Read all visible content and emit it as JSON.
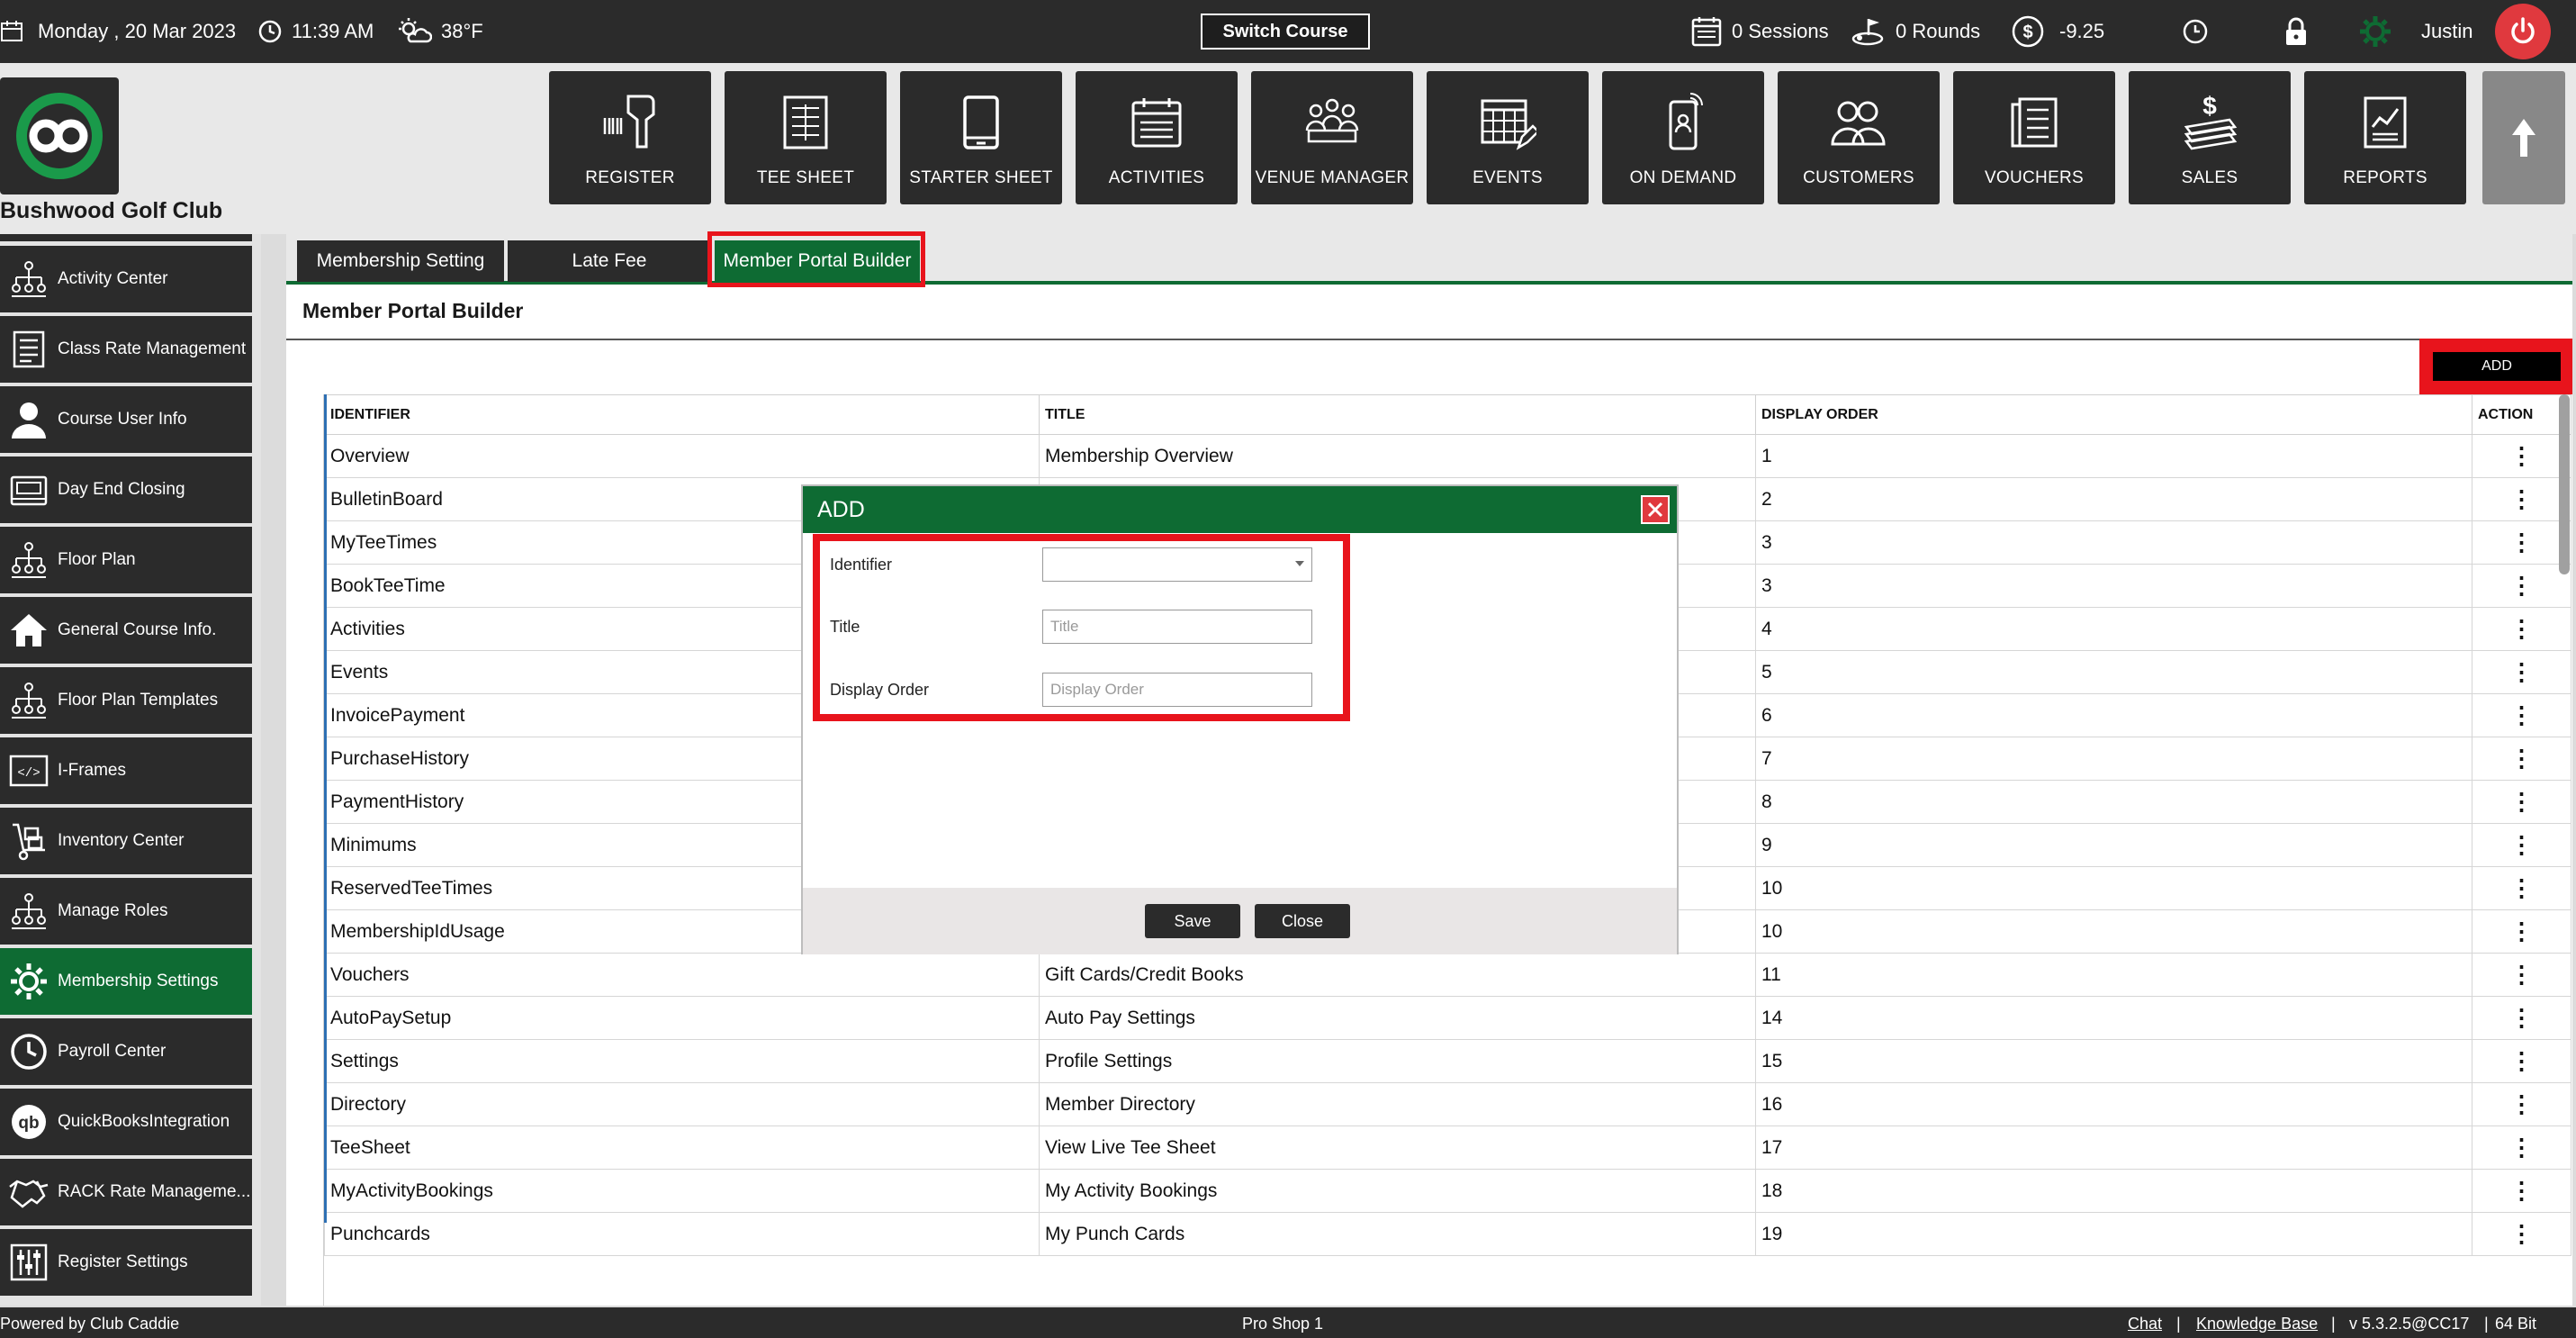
{
  "topbar": {
    "date": "Monday ,  20 Mar 2023",
    "time": "11:39 AM",
    "weather": "38°F",
    "switch_course": "Switch Course",
    "sessions": "0 Sessions",
    "rounds": "0 Rounds",
    "balance": "-9.25",
    "user": "Justin"
  },
  "club": {
    "name": "Bushwood Golf Club"
  },
  "modules": [
    {
      "label": "REGISTER",
      "icon": "barcode-scanner-icon"
    },
    {
      "label": "TEE SHEET",
      "icon": "tee-sheet-icon"
    },
    {
      "label": "STARTER SHEET",
      "icon": "tablet-icon"
    },
    {
      "label": "ACTIVITIES",
      "icon": "calendar-icon"
    },
    {
      "label": "VENUE MANAGER",
      "icon": "venue-people-icon"
    },
    {
      "label": "EVENTS",
      "icon": "events-calendar-icon"
    },
    {
      "label": "ON DEMAND",
      "icon": "mobile-phone-icon"
    },
    {
      "label": "CUSTOMERS",
      "icon": "customers-icon"
    },
    {
      "label": "VOUCHERS",
      "icon": "voucher-icon"
    },
    {
      "label": "SALES",
      "icon": "sales-money-icon"
    },
    {
      "label": "REPORTS",
      "icon": "report-chart-icon"
    }
  ],
  "sidebar": {
    "items": [
      {
        "label": "Activity  Center",
        "icon": "hierarchy-icon"
      },
      {
        "label": "Class Rate Management",
        "icon": "document-list-icon"
      },
      {
        "label": "Course User Info",
        "icon": "user-icon"
      },
      {
        "label": "Day End Closing",
        "icon": "cash-register-icon"
      },
      {
        "label": "Floor Plan",
        "icon": "hierarchy-icon"
      },
      {
        "label": "General Course Info.",
        "icon": "home-icon"
      },
      {
        "label": "Floor Plan Templates",
        "icon": "hierarchy-icon"
      },
      {
        "label": "I-Frames",
        "icon": "code-icon"
      },
      {
        "label": "Inventory Center",
        "icon": "hand-truck-icon"
      },
      {
        "label": "Manage Roles",
        "icon": "hierarchy-icon"
      },
      {
        "label": "Membership Settings",
        "icon": "gear-icon",
        "active": true
      },
      {
        "label": "Payroll Center",
        "icon": "clock-icon"
      },
      {
        "label": "QuickBooksIntegration",
        "icon": "quickbooks-icon"
      },
      {
        "label": "RACK Rate Manageme...",
        "icon": "handshake-icon"
      },
      {
        "label": "Register Settings",
        "icon": "sliders-icon"
      }
    ]
  },
  "tabs": [
    {
      "label": "Membership Setting"
    },
    {
      "label": "Late Fee"
    },
    {
      "label": "Member Portal Builder",
      "active": true
    }
  ],
  "page": {
    "title": "Member Portal Builder",
    "add_label": "ADD"
  },
  "table": {
    "headers": [
      "IDENTIFIER",
      "TITLE",
      "DISPLAY ORDER",
      "ACTION"
    ],
    "rows": [
      [
        "Overview",
        "Membership Overview",
        "1"
      ],
      [
        "BulletinBoard",
        "",
        "2"
      ],
      [
        "MyTeeTimes",
        "",
        "3"
      ],
      [
        "BookTeeTime",
        "",
        "3"
      ],
      [
        "Activities",
        "",
        "4"
      ],
      [
        "Events",
        "",
        "5"
      ],
      [
        "InvoicePayment",
        "",
        "6"
      ],
      [
        "PurchaseHistory",
        "",
        "7"
      ],
      [
        "PaymentHistory",
        "",
        "8"
      ],
      [
        "Minimums",
        "",
        "9"
      ],
      [
        "ReservedTeeTimes",
        "",
        "10"
      ],
      [
        "MembershipIdUsage",
        "",
        "10"
      ],
      [
        "Vouchers",
        "Gift Cards/Credit Books",
        "11"
      ],
      [
        "AutoPaySetup",
        "Auto Pay Settings",
        "14"
      ],
      [
        "Settings",
        "Profile Settings",
        "15"
      ],
      [
        "Directory",
        "Member Directory",
        "16"
      ],
      [
        "TeeSheet",
        "View Live Tee Sheet",
        "17"
      ],
      [
        "MyActivityBookings",
        "My Activity Bookings",
        "18"
      ],
      [
        "Punchcards",
        "My Punch Cards",
        "19"
      ]
    ],
    "action_glyph": "⋮"
  },
  "modal": {
    "title": "ADD",
    "identifier_label": "Identifier",
    "identifier_value": "",
    "title_label": "Title",
    "title_placeholder": "Title",
    "order_label": "Display Order",
    "order_placeholder": "Display Order",
    "save": "Save",
    "close": "Close"
  },
  "statusbar": {
    "powered": "Powered by Club Caddie",
    "station": "Pro Shop 1",
    "chat": "Chat",
    "sep": "|",
    "kb": "Knowledge Base",
    "version": "v 5.3.2.5@CC17",
    "bits": "64 Bit"
  },
  "colors": {
    "brand_green": "#0e6b33",
    "dark": "#2b2b2b",
    "highlight_red": "#e8141c",
    "power_red": "#e0393e"
  }
}
